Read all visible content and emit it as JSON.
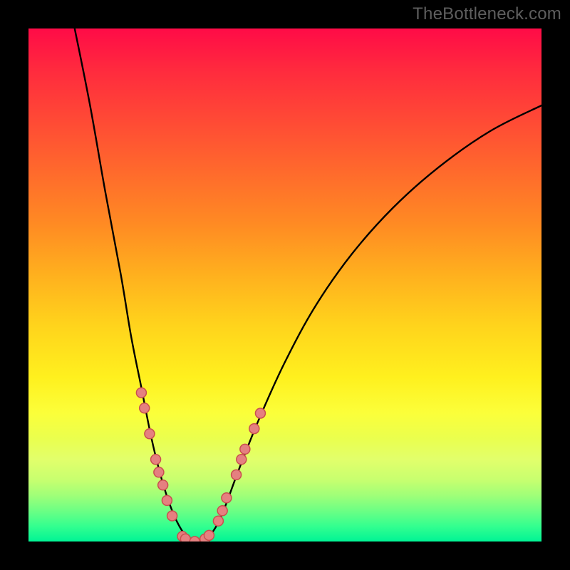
{
  "attribution": "TheBottleneck.com",
  "chart_data": {
    "type": "line",
    "title": "",
    "xlabel": "",
    "ylabel": "",
    "xlim": [
      0,
      100
    ],
    "ylim": [
      0,
      100
    ],
    "curve": {
      "name": "bottleneck-curve",
      "points": [
        {
          "x": 9,
          "y": 100
        },
        {
          "x": 12,
          "y": 85
        },
        {
          "x": 15,
          "y": 68
        },
        {
          "x": 18,
          "y": 52
        },
        {
          "x": 20,
          "y": 40
        },
        {
          "x": 22,
          "y": 30
        },
        {
          "x": 24,
          "y": 20
        },
        {
          "x": 26,
          "y": 12
        },
        {
          "x": 28,
          "y": 6
        },
        {
          "x": 30,
          "y": 2
        },
        {
          "x": 32,
          "y": 0
        },
        {
          "x": 34,
          "y": 0
        },
        {
          "x": 36,
          "y": 2
        },
        {
          "x": 38,
          "y": 6
        },
        {
          "x": 41,
          "y": 14
        },
        {
          "x": 45,
          "y": 24
        },
        {
          "x": 50,
          "y": 35
        },
        {
          "x": 56,
          "y": 46
        },
        {
          "x": 63,
          "y": 56
        },
        {
          "x": 71,
          "y": 65
        },
        {
          "x": 80,
          "y": 73
        },
        {
          "x": 90,
          "y": 80
        },
        {
          "x": 100,
          "y": 85
        }
      ]
    },
    "series": [
      {
        "name": "data-markers",
        "marker_color": "#e58080",
        "points": [
          {
            "x": 22.0,
            "y": 29
          },
          {
            "x": 22.6,
            "y": 26
          },
          {
            "x": 23.6,
            "y": 21
          },
          {
            "x": 24.8,
            "y": 16
          },
          {
            "x": 25.4,
            "y": 13.5
          },
          {
            "x": 26.2,
            "y": 11
          },
          {
            "x": 27.0,
            "y": 8
          },
          {
            "x": 28.0,
            "y": 5
          },
          {
            "x": 30.0,
            "y": 1
          },
          {
            "x": 30.6,
            "y": 0.5
          },
          {
            "x": 32.4,
            "y": 0
          },
          {
            "x": 34.4,
            "y": 0.5
          },
          {
            "x": 35.2,
            "y": 1.2
          },
          {
            "x": 37.0,
            "y": 4
          },
          {
            "x": 37.8,
            "y": 6
          },
          {
            "x": 38.6,
            "y": 8.5
          },
          {
            "x": 40.5,
            "y": 13
          },
          {
            "x": 41.5,
            "y": 16
          },
          {
            "x": 42.2,
            "y": 18
          },
          {
            "x": 44.0,
            "y": 22
          },
          {
            "x": 45.2,
            "y": 25
          }
        ]
      }
    ]
  }
}
